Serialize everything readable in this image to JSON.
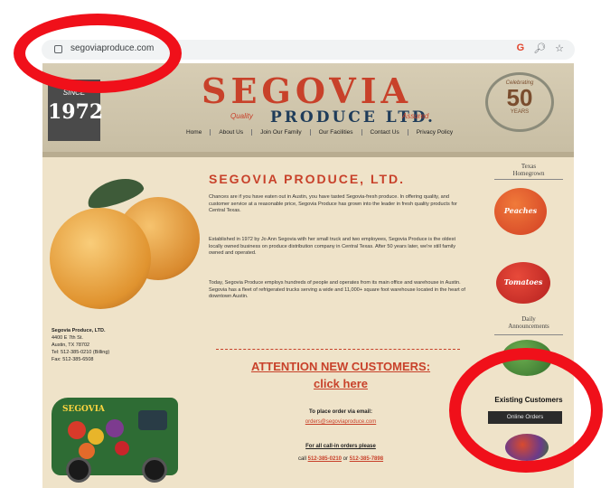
{
  "browser": {
    "url": "segoviaproduce.com",
    "icons": [
      "google-icon",
      "zoom-icon",
      "star-icon"
    ]
  },
  "header": {
    "since_label": "SINCE",
    "since_year": "1972",
    "logo_name": "SEGOVIA",
    "logo_sub": "PRODUCE LTD.",
    "logo_left": "Quality",
    "logo_right": "Assured",
    "badge_top": "Celebrating",
    "badge_number": "50",
    "badge_bottom": "YEARS"
  },
  "nav": [
    "Home",
    "About Us",
    "Join Our Family",
    "Our Facilities",
    "Contact Us",
    "Privacy Policy"
  ],
  "main": {
    "title": "SEGOVIA PRODUCE, LTD.",
    "paragraphs": [
      "Chances are if you have eaten out in Austin, you have tasted Segovia-fresh produce. In offering quality, and customer service at a reasonable price, Segovia Produce has grown into the leader in fresh quality products for Central Texas.",
      "Established in 1972 by Jo Ann Segovia with her small truck and two employees, Segovia Produce is the oldest locally owned business on produce distribution company in Central Texas. After 50 years later, we're still family owned and operated.",
      "Today, Segovia Produce employs hundreds of people and operates from its main office and warehouse in Austin. Segovia has a fleet of refrigerated trucks serving a wide and 11,000+ square foot warehouse located in the heart of downtown Austin."
    ],
    "attention": "ATTENTION NEW CUSTOMERS:",
    "click_here": "click here",
    "order_label": "To place order via email:",
    "order_email": "orders@segoviaproduce.com",
    "callin_label": "For all call-in orders please",
    "callin_prefix": "call",
    "callin_phone1": "512-385-0210",
    "callin_or": "or",
    "callin_phone2": "512-385-7898"
  },
  "address": {
    "lines": [
      "Segovia Produce, LTD.",
      "4400 E 7th St.",
      "Austin, TX 78702",
      "Tel: 512-385-0210 (Billing)",
      "Fax: 512-385-6508"
    ]
  },
  "van": {
    "brand": "SEGOVIA"
  },
  "sidebar": {
    "texas_head": [
      "Texas",
      "Homegrown"
    ],
    "fruit1": "Peaches",
    "fruit2": "Tomatoes",
    "daily_head": [
      "Daily",
      "Announcements"
    ],
    "existing": "Existing Customers",
    "online_orders": "Online Orders"
  },
  "colors": {
    "annotation_red": "#f0101a",
    "brand_red": "#c8412a",
    "brand_navy": "#1f3c5a"
  }
}
